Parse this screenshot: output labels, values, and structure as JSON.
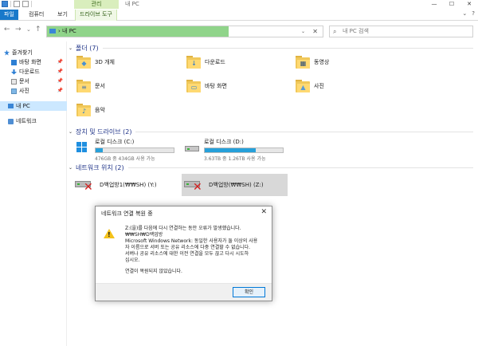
{
  "titlebar": {
    "context_tab": "관리",
    "window_title": "내 PC",
    "minimize": "—",
    "maximize": "☐",
    "close": "✕"
  },
  "ribbon": {
    "tabs": [
      "파일",
      "컴퓨터",
      "보기",
      "드라이브 도구"
    ],
    "expand": "⌄",
    "help": "?"
  },
  "address": {
    "back": "←",
    "forward": "→",
    "recent": "⌄",
    "up": "↑",
    "breadcrumb": "›  내 PC",
    "dropdown": "⌄",
    "clear": "✕",
    "search_placeholder": "내 PC 검색"
  },
  "sidebar": {
    "items": [
      {
        "label": "즐겨찾기",
        "icon": "star-icon"
      },
      {
        "label": "바탕 화면",
        "icon": "desktop-icon",
        "pin": "📌"
      },
      {
        "label": "다운로드",
        "icon": "download-icon",
        "pin": "📌"
      },
      {
        "label": "문서",
        "icon": "document-icon",
        "pin": "📌"
      },
      {
        "label": "사진",
        "icon": "picture-icon",
        "pin": "📌"
      },
      {
        "label": "내 PC",
        "icon": "pc-icon"
      },
      {
        "label": "네트워크",
        "icon": "network-icon"
      }
    ]
  },
  "sections": {
    "folders": "폴더 (7)",
    "devices": "장치 및 드라이브 (2)",
    "network": "네트워크 위치 (2)"
  },
  "folders": [
    {
      "label": "3D 개체",
      "glyph": "◆"
    },
    {
      "label": "다운로드",
      "glyph": "↓"
    },
    {
      "label": "동영상",
      "glyph": "▦"
    },
    {
      "label": "문서",
      "glyph": "≡"
    },
    {
      "label": "바탕 화면",
      "glyph": "▭"
    },
    {
      "label": "사진",
      "glyph": "▲"
    },
    {
      "label": "음악",
      "glyph": "♪"
    }
  ],
  "drives": [
    {
      "label": "로컬 디스크 (C:)",
      "free": "476GB 중 434GB 사용 가능",
      "used_fraction": 0.09
    },
    {
      "label": "로컬 디스크 (D:)",
      "free": "3.63TB 중 1.26TB 사용 가능",
      "used_fraction": 0.65
    }
  ],
  "network_locations": [
    {
      "label": "D백업방1(₩₩SH) (Y:)"
    },
    {
      "label": "D백업방(₩₩SH) (Z:)"
    }
  ],
  "dialog": {
    "title": "네트워크 연결 복원 중",
    "close": "✕",
    "line1": "Z:(을)를 다음에 다시 연결하는 동안 오류가 발생했습니다.",
    "line2": "₩₩SH₩D백업방",
    "line3": "Microsoft Windows Network: 동일한 사용자가 둘 이상의 사용",
    "line4": "자 이름으로 서버 또는 공유 리소스에 다중 연결할 수 없습니다.",
    "line5": "서버나 공유 리소스에 대한 이전 연결을 모두 끊고 다시 시도하",
    "line6": "십시오.",
    "line7": "연결이 복원되지 않았습니다.",
    "ok": "확인"
  },
  "colors": {
    "accent": "#1979ca",
    "address_fill": "#90d48a",
    "drive_bar": "#26a0da",
    "error_red": "#d31f1f",
    "warning_yellow": "#f4c21a"
  }
}
